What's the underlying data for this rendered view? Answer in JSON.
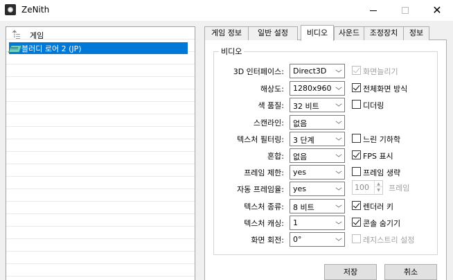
{
  "window": {
    "title": "ZeNith"
  },
  "tree": {
    "root_label": "게임",
    "child_label": "블러디 로어 2 (JP)"
  },
  "tabs": [
    "게임 정보",
    "일반 설정",
    "비디오",
    "사운드",
    "조정장치",
    "정보"
  ],
  "active_tab": "비디오",
  "group": {
    "title": "비디오"
  },
  "fields": [
    {
      "label": "3D 인터페이스:",
      "value": "Direct3D"
    },
    {
      "label": "해상도:",
      "value": "1280x960"
    },
    {
      "label": "색 품질:",
      "value": "32 비트"
    },
    {
      "label": "스캔라인:",
      "value": "없음"
    },
    {
      "label": "텍스처 필터링:",
      "value": "3 단계"
    },
    {
      "label": "혼합:",
      "value": "없음"
    },
    {
      "label": "프레임 제한:",
      "value": "yes"
    },
    {
      "label": "자동 프레임율:",
      "value": "yes"
    },
    {
      "label": "텍스처 종류:",
      "value": "8 비트"
    },
    {
      "label": "텍스처 캐싱:",
      "value": "1"
    },
    {
      "label": "화면 회전:",
      "value": "0°"
    }
  ],
  "checkboxes": [
    {
      "label": "화면늘리기",
      "checked": true,
      "disabled": true
    },
    {
      "label": "전체화면 방식",
      "checked": true,
      "disabled": false
    },
    {
      "label": "디더링",
      "checked": false,
      "disabled": false
    },
    {
      "label": "느린 기하학",
      "checked": false,
      "disabled": false
    },
    {
      "label": "FPS 표시",
      "checked": true,
      "disabled": false
    },
    {
      "label": "프레임 생략",
      "checked": false,
      "disabled": false
    },
    {
      "label": "렌더러 키",
      "checked": true,
      "disabled": false
    },
    {
      "label": "콘솔 숨기기",
      "checked": true,
      "disabled": false
    },
    {
      "label": "레지스트리 설정",
      "checked": false,
      "disabled": true
    }
  ],
  "frame_spinner": {
    "value": "100",
    "label": "프레임"
  },
  "buttons": {
    "save": "저장",
    "cancel": "취소"
  }
}
